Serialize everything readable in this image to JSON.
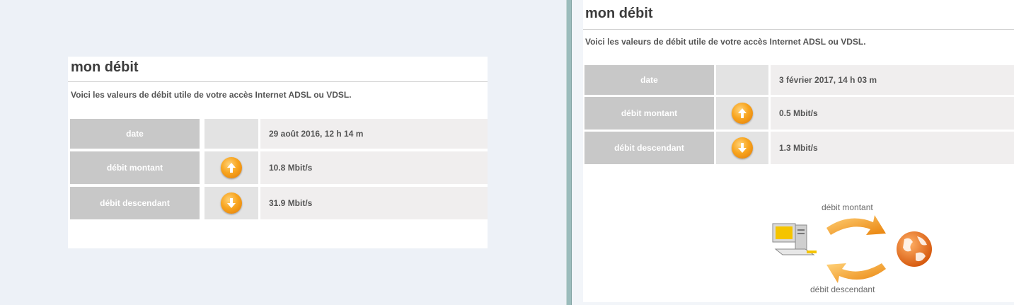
{
  "left": {
    "title": "mon débit",
    "description": "Voici les valeurs de débit utile de votre accès Internet ADSL ou VDSL.",
    "rows": [
      {
        "label": "date",
        "icon": "",
        "value": "29 août 2016, 12 h 14 m"
      },
      {
        "label": "débit montant",
        "icon": "arrow-up-icon",
        "value": "10.8 Mbit/s"
      },
      {
        "label": "débit descendant",
        "icon": "arrow-down-icon",
        "value": "31.9 Mbit/s"
      }
    ]
  },
  "right": {
    "title": "mon débit",
    "description": "Voici les valeurs de débit utile de votre accès Internet ADSL ou VDSL.",
    "rows": [
      {
        "label": "date",
        "icon": "",
        "value": "3 février 2017, 14 h 03 m"
      },
      {
        "label": "débit montant",
        "icon": "arrow-up-icon",
        "value": "0.5 Mbit/s"
      },
      {
        "label": "débit descendant",
        "icon": "arrow-down-icon",
        "value": "1.3 Mbit/s"
      }
    ],
    "illustration": {
      "upload_label": "débit montant",
      "download_label": "débit descendant",
      "icons": [
        "computer-icon",
        "globe-icon",
        "cycle-arrows-icon"
      ]
    }
  },
  "colors": {
    "page_bg": "#edf1f7",
    "label_cell": "#c8c8c8",
    "icon_cell": "#e3e3e3",
    "value_cell": "#f0eeee",
    "accent_orange": "#f39a1a",
    "divider": "#9bbcbc"
  }
}
